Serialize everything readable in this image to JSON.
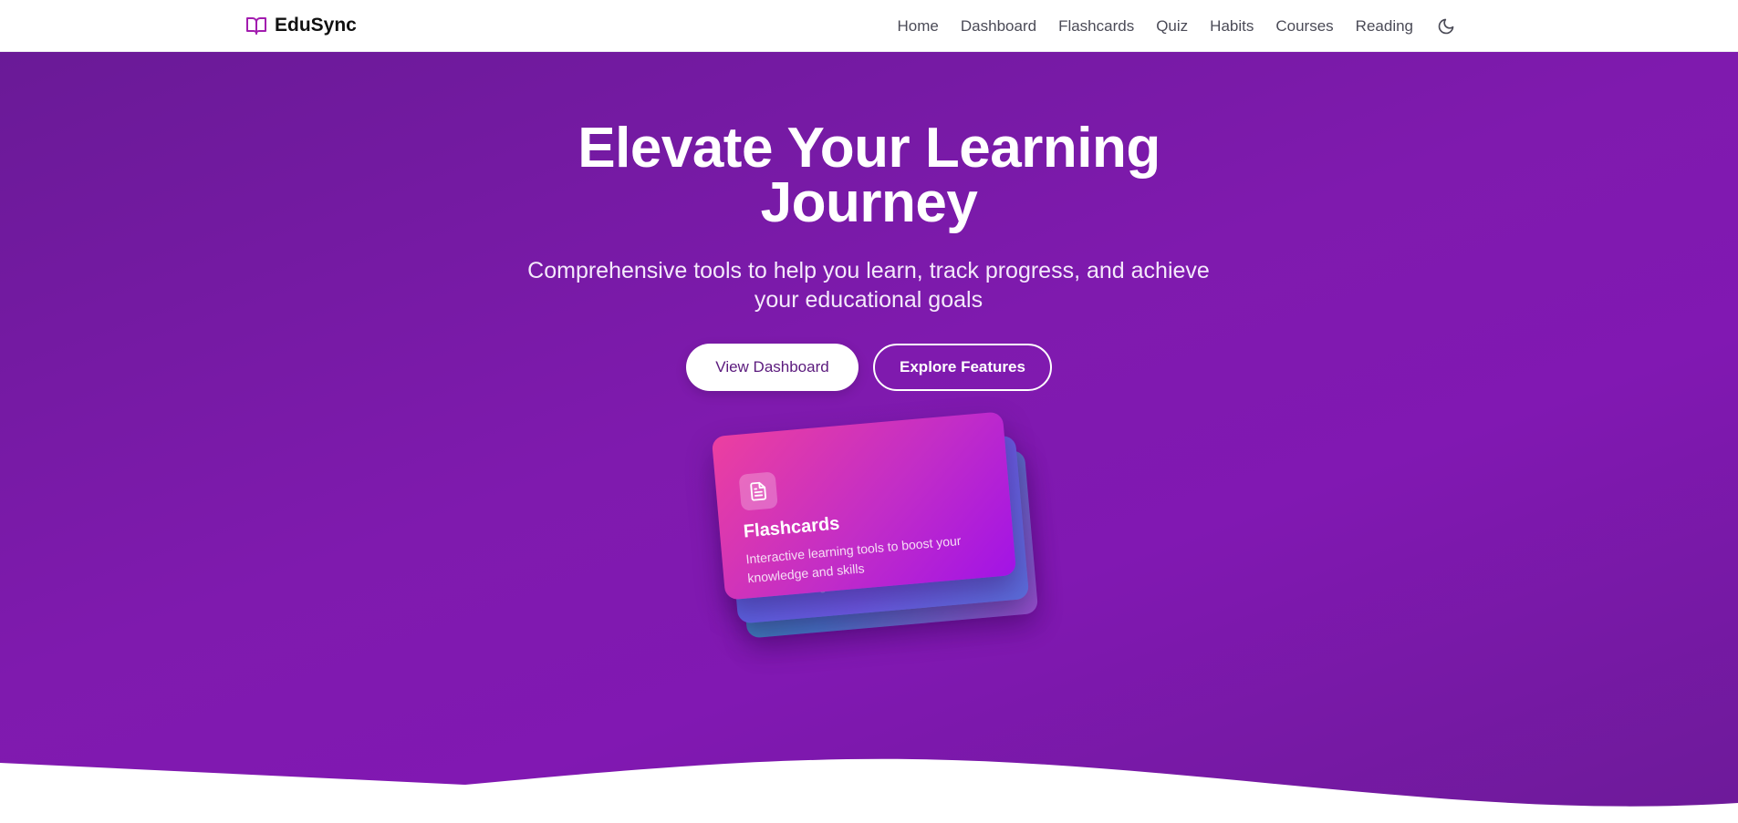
{
  "brand": {
    "name": "EduSync",
    "icon": "book-open-icon"
  },
  "nav": {
    "links": [
      "Home",
      "Dashboard",
      "Flashcards",
      "Quiz",
      "Habits",
      "Courses",
      "Reading"
    ],
    "theme_toggle_icon": "moon-icon"
  },
  "hero": {
    "title_line1": "Elevate Your Learning",
    "title_line2": "Journey",
    "subtitle": "Comprehensive tools to help you learn, track progress, and achieve your educational goals",
    "primary_button": "View Dashboard",
    "secondary_button": "Explore Features"
  },
  "card": {
    "icon": "document-icon",
    "title": "Flashcards",
    "description": "Interactive learning tools to boost your knowledge and skills",
    "back_card_text": "knowledge and skills"
  },
  "colors": {
    "brand_accent": "#a21caf",
    "hero_bg": "#7f1aae",
    "primary_button_text": "#5b1a7d"
  }
}
